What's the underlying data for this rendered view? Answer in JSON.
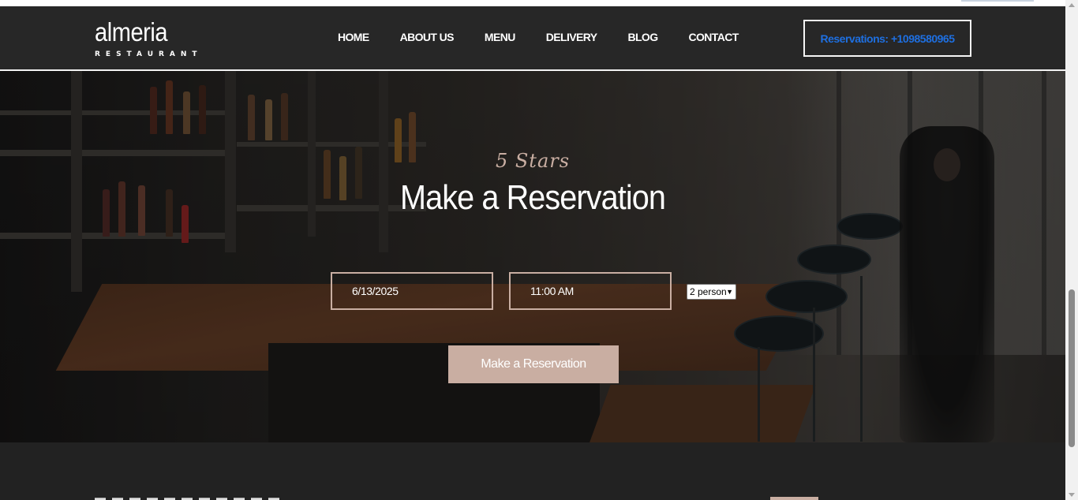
{
  "brand": {
    "name": "almeria",
    "subtitle": "RESTAURANT"
  },
  "nav": {
    "items": [
      {
        "label": "HOME"
      },
      {
        "label": "ABOUT US"
      },
      {
        "label": "MENU"
      },
      {
        "label": "DELIVERY"
      },
      {
        "label": "BLOG"
      },
      {
        "label": "CONTACT"
      }
    ]
  },
  "header": {
    "reservation_phone": "Reservations: +1098580965"
  },
  "hero": {
    "rating_text": "5 Stars",
    "title": "Make a Reservation",
    "date_value": "6/13/2025",
    "time_value": "11:00 AM",
    "party_size": {
      "selected": "2 person"
    },
    "button_label": "Make a Reservation"
  },
  "colors": {
    "accent": "#c9aea2",
    "header_bg": "#272727",
    "phone_link": "#1e6fe0",
    "page_bg": "#212121"
  },
  "icons": {
    "select_caret": "chevron-down-icon"
  }
}
